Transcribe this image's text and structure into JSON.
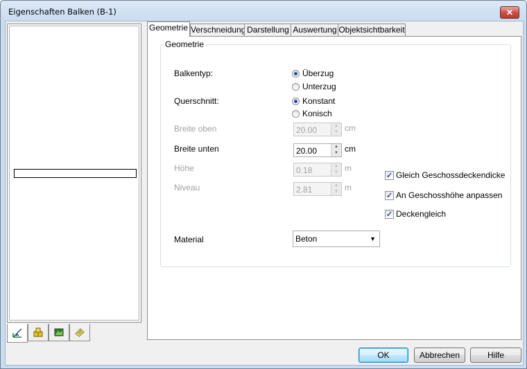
{
  "window": {
    "title": "Eigenschaften Balken (B-1)"
  },
  "icons": {
    "close": "close-icon",
    "left_tabs": [
      "dimension-icon",
      "layers-icon",
      "image-icon",
      "note-icon"
    ]
  },
  "tabs": [
    "Geometrie",
    "Verschneidung",
    "Darstellung",
    "Auswertung",
    "Objektsichtbarkeit"
  ],
  "group": {
    "label": "Geometrie"
  },
  "balkentyp": {
    "label": "Balkentyp:",
    "options": [
      "Überzug",
      "Unterzug"
    ],
    "selected": "Überzug"
  },
  "querschnitt": {
    "label": "Querschnitt:",
    "options": [
      "Konstant",
      "Konisch"
    ],
    "selected": "Konstant"
  },
  "fields": {
    "breite_oben": {
      "label": "Breite oben",
      "value": "20.00",
      "unit": "cm"
    },
    "breite_unten": {
      "label": "Breite unten",
      "value": "20.00",
      "unit": "cm"
    },
    "hoehe": {
      "label": "Höhe",
      "value": "0.18",
      "unit": "m"
    },
    "niveau": {
      "label": "Niveau",
      "value": "2.81",
      "unit": "m"
    }
  },
  "checks": {
    "gleich": {
      "label": "Gleich Geschossdeckendicke",
      "checked": true
    },
    "anpassen": {
      "label": "An Geschosshöhe anpassen",
      "checked": true
    },
    "deckengleich": {
      "label": "Deckengleich",
      "checked": true
    }
  },
  "material": {
    "label": "Material",
    "value": "Beton"
  },
  "buttons": {
    "ok": "OK",
    "cancel": "Abbrechen",
    "help": "Hilfe"
  }
}
